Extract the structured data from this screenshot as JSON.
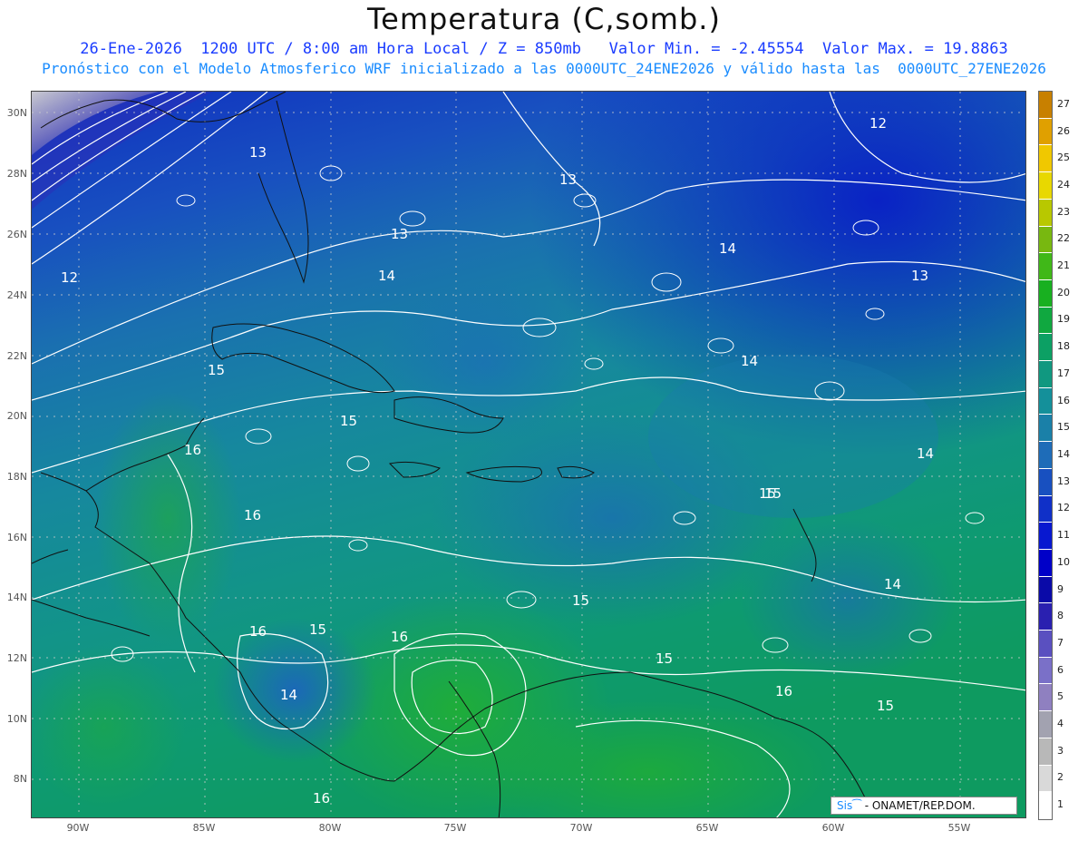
{
  "header": {
    "title": "Temperatura (C,somb.)",
    "line1": "26-Ene-2026  1200 UTC / 8:00 am Hora Local / Z = 850mb   Valor Min. = -2.45554  Valor Max. = 19.8863",
    "line2": "Pronóstico con el Modelo Atmosferico WRF inicializado a las 0000UTC_24ENE2026 y válido hasta las  0000UTC_27ENE2026"
  },
  "axes": {
    "lat_labels": [
      "30N",
      "28N",
      "26N",
      "24N",
      "22N",
      "20N",
      "18N",
      "16N",
      "14N",
      "12N",
      "10N",
      "8N"
    ],
    "lon_labels": [
      "90W",
      "85W",
      "80W",
      "75W",
      "70W",
      "65W",
      "60W",
      "55W"
    ]
  },
  "contour_labels": [
    "13",
    "13",
    "13",
    "14",
    "12",
    "14",
    "12",
    "13",
    "14",
    "15",
    "15",
    "16",
    "16",
    "16",
    "15",
    "14",
    "16",
    "15",
    "15",
    "16",
    "15",
    "14",
    "14",
    "15",
    "15",
    "16"
  ],
  "colorbar": {
    "labels": [
      "1",
      "2",
      "3",
      "4",
      "5",
      "6",
      "7",
      "8",
      "9",
      "10",
      "11",
      "12",
      "13",
      "14",
      "15",
      "16",
      "17",
      "18",
      "19",
      "20",
      "21",
      "22",
      "23",
      "24",
      "25",
      "26",
      "27"
    ],
    "colors": [
      "#ffffff",
      "#d9d9d9",
      "#b8b8b8",
      "#a2a2b0",
      "#8f80c0",
      "#7a70c8",
      "#5a50c0",
      "#2a20b0",
      "#0a0aa8",
      "#0000c8",
      "#0818d0",
      "#1030c8",
      "#1850c0",
      "#1e6cb8",
      "#1a80a8",
      "#14909a",
      "#109880",
      "#0ca064",
      "#10a840",
      "#18b020",
      "#40b818",
      "#78b810",
      "#b8c800",
      "#e8d800",
      "#f0c800",
      "#e0a000",
      "#c88000"
    ]
  },
  "credit": {
    "sis": "Sis",
    "text": "- ONAMET/REP.DOM."
  }
}
